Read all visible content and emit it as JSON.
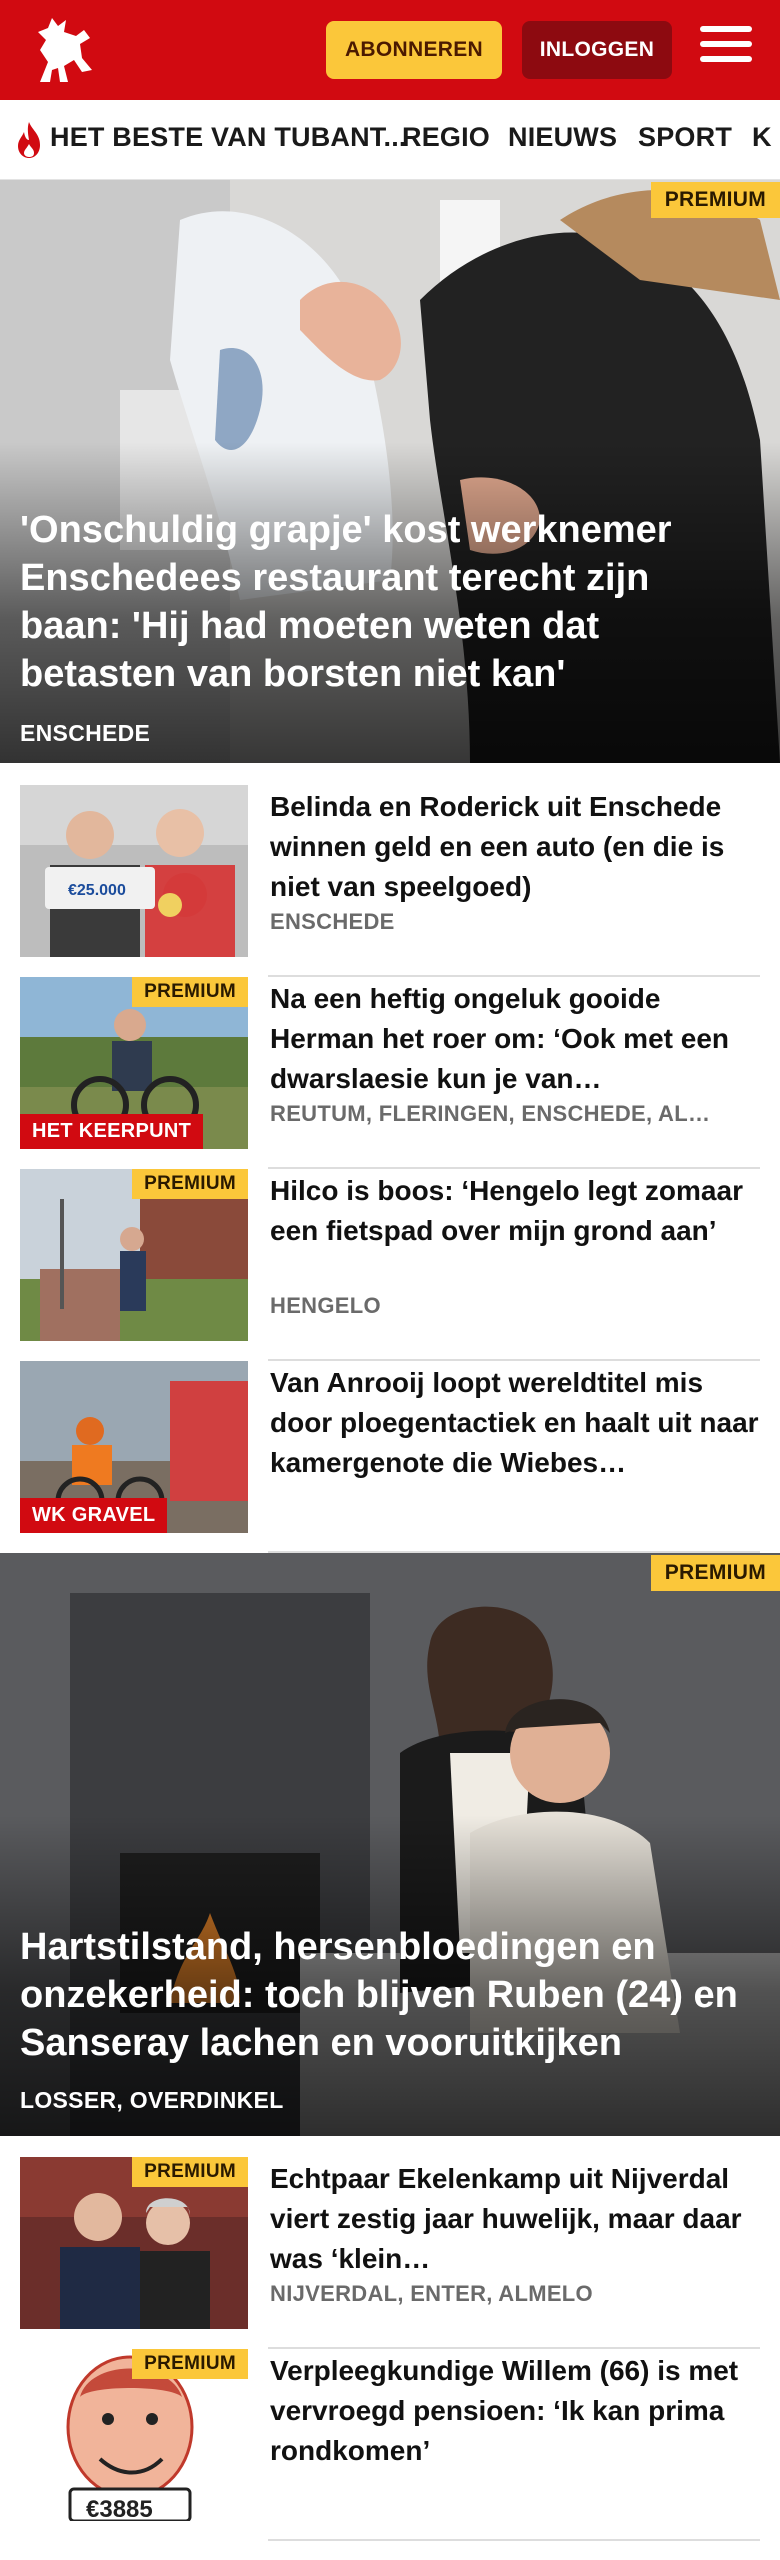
{
  "header": {
    "subscribe_label": "ABONNEREN",
    "login_label": "INLOGGEN",
    "brand_color": "#d10a11"
  },
  "nav": {
    "items": [
      "HET BESTE VAN TUBANT...",
      "REGIO",
      "NIEUWS",
      "SPORT",
      "K"
    ]
  },
  "hero1": {
    "badge": "PREMIUM",
    "title": "'Onschuldig grapje' kost werknemer Enschedees restaurant terecht zijn baan: 'Hij had moeten weten dat betasten van borsten niet kan'",
    "location": "ENSCHEDE"
  },
  "list1": [
    {
      "title": "Belinda en Roderick uit Enschede winnen geld en een auto (en die is niet van speelgoed)",
      "location": "ENSCHEDE",
      "badge": "",
      "label": "",
      "sign_text": "€25.000"
    },
    {
      "title": "Na een heftig ongeluk gooide Herman het roer om: ‘Ook met een dwarslaesie kun je van…",
      "location": "REUTUM, FLERINGEN, ENSCHEDE, AL…",
      "badge": "PREMIUM",
      "label": "HET KEERPUNT"
    },
    {
      "title": "Hilco is boos: ‘Hengelo legt zomaar een fietspad over mijn grond aan’",
      "location": "HENGELO",
      "badge": "PREMIUM",
      "label": ""
    },
    {
      "title": "Van Anrooij loopt wereldtitel mis door ploegentactiek en haalt uit naar kamergenote die Wiebes…",
      "location": "",
      "badge": "",
      "label": "WK GRAVEL"
    }
  ],
  "hero2": {
    "badge": "PREMIUM",
    "title": "Hartstilstand, hersenbloedingen en onzekerheid: toch blijven Ruben (24) en Sanseray lachen en vooruitkijken",
    "location": "LOSSER, OVERDINKEL"
  },
  "list2": [
    {
      "title": "Echtpaar Ekelenkamp uit Nijverdal viert zestig jaar huwelijk, maar daar was ‘klein…",
      "location": "NIJVERDAL, ENTER, ALMELO",
      "badge": "PREMIUM"
    },
    {
      "title": "Verpleegkundige Willem (66) is met vervroegd pensioen: ‘Ik kan prima rondkomen’",
      "location": "",
      "badge": "PREMIUM",
      "sign_text": "€3885"
    }
  ]
}
